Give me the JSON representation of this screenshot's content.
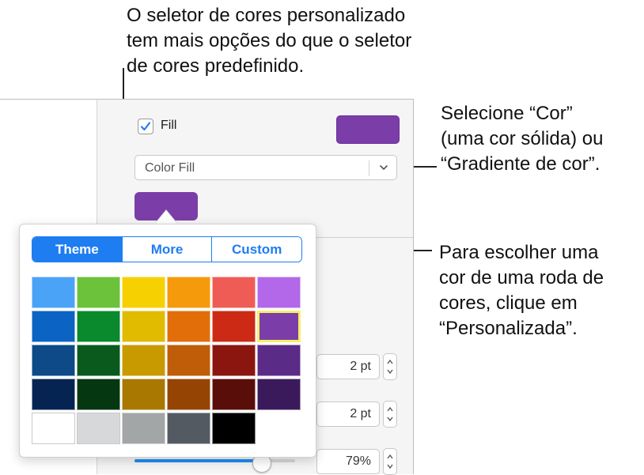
{
  "callouts": {
    "top": "O seletor de cores personalizado\ntem mais opções do que o seletor\nde cores predefinido.",
    "right_top": "Selecione “Cor”\n(uma cor sólida) ou\n“Gradiente de cor”.",
    "right_bottom": "Para escolher uma\ncor de uma roda de\ncores, clique em\n“Personalizada”."
  },
  "fill": {
    "label": "Fill",
    "checked": true,
    "color": "#7b3ea8",
    "select_value": "Color Fill"
  },
  "color_well_color": "#7b3ea8",
  "popover": {
    "tabs": [
      {
        "label": "Theme",
        "active": true
      },
      {
        "label": "More",
        "active": false
      },
      {
        "label": "Custom",
        "active": false
      }
    ],
    "accent": "#1e7df0",
    "selected_color": "#7b3ea8",
    "palette": [
      [
        "#4ba3f7",
        "#6cc23a",
        "#f6d000",
        "#f59a0a",
        "#ef5c55",
        "#b268e8"
      ],
      [
        "#0b63c3",
        "#0a8a2c",
        "#e0bb00",
        "#e26e0a",
        "#cc2a14",
        "#7b3ea8"
      ],
      [
        "#0d4a87",
        "#0a5a1d",
        "#c99a00",
        "#c05d08",
        "#8b1610",
        "#5b2b88"
      ],
      [
        "#062452",
        "#053710",
        "#a87800",
        "#964404",
        "#5a0e0a",
        "#3b1a5c"
      ],
      [
        "#ffffff",
        "#d7d8da",
        "#a3a6a7",
        "#535a62",
        "#000000"
      ]
    ]
  },
  "steppers": [
    {
      "value": "2 pt"
    },
    {
      "value": "2 pt"
    },
    {
      "value": "79%"
    }
  ],
  "slider": {
    "value": 0.79
  }
}
